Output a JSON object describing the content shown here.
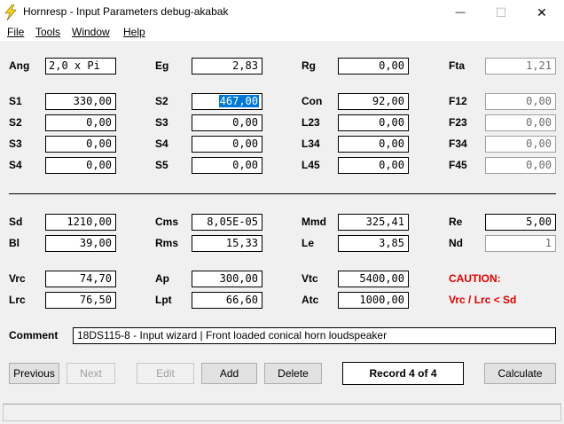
{
  "window": {
    "title": "Hornresp - Input Parameters   debug-akabak",
    "minimize_glyph": "—",
    "maximize_glyph": "☐",
    "close_glyph": "✕"
  },
  "menu": [
    "File",
    "Tools",
    "Window",
    "Help"
  ],
  "fields": {
    "ang": {
      "label": "Ang",
      "value": "2,0 x Pi"
    },
    "eg": {
      "label": "Eg",
      "value": "2,83"
    },
    "rg": {
      "label": "Rg",
      "value": "0,00"
    },
    "fta": {
      "label": "Fta",
      "value": "1,21"
    },
    "s1a": {
      "label": "S1",
      "value": "330,00"
    },
    "s2b": {
      "label": "S2",
      "value": "467,00"
    },
    "con": {
      "label": "Con",
      "value": "92,00"
    },
    "f12": {
      "label": "F12",
      "value": "0,00"
    },
    "s2a": {
      "label": "S2",
      "value": "0,00"
    },
    "s3b": {
      "label": "S3",
      "value": "0,00"
    },
    "l23": {
      "label": "L23",
      "value": "0,00"
    },
    "f23": {
      "label": "F23",
      "value": "0,00"
    },
    "s3a": {
      "label": "S3",
      "value": "0,00"
    },
    "s4b": {
      "label": "S4",
      "value": "0,00"
    },
    "l34": {
      "label": "L34",
      "value": "0,00"
    },
    "f34": {
      "label": "F34",
      "value": "0,00"
    },
    "s4a": {
      "label": "S4",
      "value": "0,00"
    },
    "s5b": {
      "label": "S5",
      "value": "0,00"
    },
    "l45": {
      "label": "L45",
      "value": "0,00"
    },
    "f45": {
      "label": "F45",
      "value": "0,00"
    },
    "sd": {
      "label": "Sd",
      "value": "1210,00"
    },
    "cms": {
      "label": "Cms",
      "value": "8,05E-05"
    },
    "mmd": {
      "label": "Mmd",
      "value": "325,41"
    },
    "re": {
      "label": "Re",
      "value": "5,00"
    },
    "bl": {
      "label": "Bl",
      "value": "39,00"
    },
    "rms": {
      "label": "Rms",
      "value": "15,33"
    },
    "le": {
      "label": "Le",
      "value": "3,85"
    },
    "nd": {
      "label": "Nd",
      "value": "1"
    },
    "vrc": {
      "label": "Vrc",
      "value": "74,70"
    },
    "ap": {
      "label": "Ap",
      "value": "300,00"
    },
    "vtc": {
      "label": "Vtc",
      "value": "5400,00"
    },
    "lrc": {
      "label": "Lrc",
      "value": "76,50"
    },
    "lpt": {
      "label": "Lpt",
      "value": "66,60"
    },
    "atc": {
      "label": "Atc",
      "value": "1000,00"
    }
  },
  "caution": {
    "title": "CAUTION:",
    "message": "Vrc / Lrc < Sd",
    "color": "#e00000"
  },
  "comment": {
    "label": "Comment",
    "value": "18DS115-8 - Input wizard | Front loaded conical horn loudspeaker"
  },
  "buttons": {
    "previous": "Previous",
    "next": "Next",
    "edit": "Edit",
    "add": "Add",
    "delete": "Delete",
    "calculate": "Calculate"
  },
  "record": "Record 4 of 4",
  "selection_color": "#0078d7"
}
